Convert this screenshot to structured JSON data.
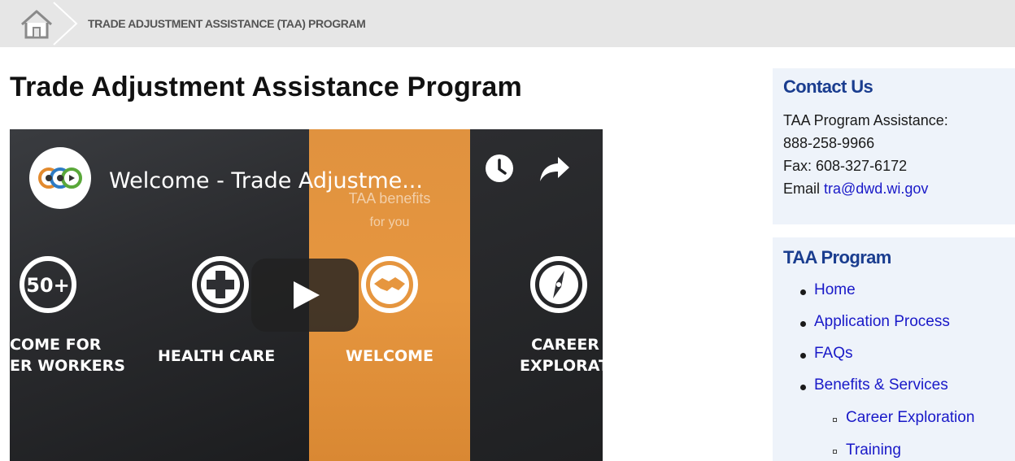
{
  "breadcrumb": {
    "home_icon": "home-icon",
    "current": "TRADE ADJUSTMENT ASSISTANCE (TAA) PROGRAM"
  },
  "page": {
    "title": "Trade Adjustment Assistance Program"
  },
  "video": {
    "title": "Welcome - Trade Adjustme...",
    "overlay_line1": "TAA benefits",
    "overlay_line2": "for you",
    "tiles": [
      {
        "icon": "fifty-plus-icon",
        "badge": "50+",
        "line1": "COME FOR",
        "line2": "ER WORKERS"
      },
      {
        "icon": "medical-cross-icon",
        "line1": "HEALTH CARE"
      },
      {
        "icon": "handshake-icon",
        "line1": "WELCOME"
      },
      {
        "icon": "compass-icon",
        "line1": "CAREER",
        "line2": "EXPLORATIO"
      }
    ],
    "colors": {
      "accent": "#e6963f",
      "dark": "#1e1f22"
    }
  },
  "contact": {
    "heading": "Contact Us",
    "line1": "TAA Program Assistance:",
    "phone": "888-258-9966",
    "fax": "Fax: 608-327-6172",
    "email_prefix": "Email ",
    "email": "tra@dwd.wi.gov"
  },
  "taa_nav": {
    "heading": "TAA Program",
    "items": [
      "Home",
      "Application Process",
      "FAQs",
      "Benefits & Services"
    ],
    "sub_items": [
      "Career Exploration",
      "Training"
    ]
  },
  "colors": {
    "heading_blue": "#1a3d8f",
    "link_blue": "#1919c8",
    "sidebar_bg": "#eef3fa",
    "breadcrumb_bg": "#e6e6e6"
  }
}
